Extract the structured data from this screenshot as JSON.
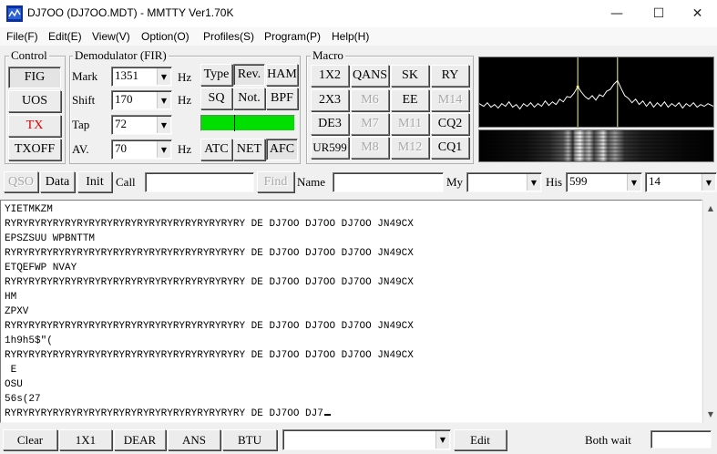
{
  "window": {
    "title": "DJ7OO (DJ7OO.MDT) - MMTTY Ver1.70K",
    "min_glyph": "—",
    "max_glyph": "☐",
    "close_glyph": "✕"
  },
  "menu": [
    "File(F)",
    "Edit(E)",
    "View(V)",
    "Option(O)",
    "Profiles(S)",
    "Program(P)",
    "Help(H)"
  ],
  "control": {
    "legend": "Control",
    "fig": "FIG",
    "uos": "UOS",
    "tx": "TX",
    "txoff": "TXOFF"
  },
  "demod": {
    "legend": "Demodulator (FIR)",
    "mark_label": "Mark",
    "mark_value": "1351",
    "shift_label": "Shift",
    "shift_value": "170",
    "tap_label": "Tap",
    "tap_value": "72",
    "av_label": "AV.",
    "av_value": "70",
    "hz": "Hz",
    "type": "Type",
    "rev": "Rev.",
    "ham": "HAM",
    "sq": "SQ",
    "not": "Not.",
    "bpf": "BPF",
    "atc": "ATC",
    "net": "NET",
    "afc": "AFC"
  },
  "macro": {
    "legend": "Macro",
    "buttons": [
      "1X2",
      "QANS",
      "SK",
      "RY",
      "2X3",
      "M6",
      "EE",
      "M14",
      "DE3",
      "M7",
      "M11",
      "CQ2",
      "UR599",
      "M8",
      "M12",
      "CQ1"
    ]
  },
  "qso_bar": {
    "qso": "QSO",
    "data": "Data",
    "init": "Init",
    "call_label": "Call",
    "call_value": "",
    "find": "Find",
    "name_label": "Name",
    "name_value": "",
    "my_label": "My",
    "my_value": "",
    "his_label": "His",
    "his_value": "599",
    "band_value": "14"
  },
  "rx_text": [
    "YIETMKZM",
    "RYRYRYRYRYRYRYRYRYRYRYRYRYRYRYRYRYRYRYRY DE DJ7OO DJ7OO DJ7OO JN49CX",
    "EPSZSUU WPBNTTM",
    "RYRYRYRYRYRYRYRYRYRYRYRYRYRYRYRYRYRYRYRY DE DJ7OO DJ7OO DJ7OO JN49CX",
    "ETQEFWP NVAY",
    "RYRYRYRYRYRYRYRYRYRYRYRYRYRYRYRYRYRYRYRY DE DJ7OO DJ7OO DJ7OO JN49CX",
    "HM",
    "ZPXV",
    "RYRYRYRYRYRYRYRYRYRYRYRYRYRYRYRYRYRYRYRY DE DJ7OO DJ7OO DJ7OO JN49CX",
    "1h9h5$\"(",
    "RYRYRYRYRYRYRYRYRYRYRYRYRYRYRYRYRYRYRYRY DE DJ7OO DJ7OO DJ7OO JN49CX",
    " E",
    "OSU",
    "56s(27",
    "RYRYRYRYRYRYRYRYRYRYRYRYRYRYRYRYRYRYRYRY DE DJ7OO DJ7"
  ],
  "toolbar": {
    "clear": "Clear",
    "b1x1": "1X1",
    "dear": "DEAR",
    "ans": "ANS",
    "btu": "BTU",
    "combo_value": "",
    "edit": "Edit",
    "both_wait": "Both wait"
  },
  "colors": {
    "tx_text": "#e00000",
    "level_meter": "#00e000",
    "scope_bg": "#000000",
    "scope_trace": "#ffffff",
    "marker": "#ffff80"
  }
}
